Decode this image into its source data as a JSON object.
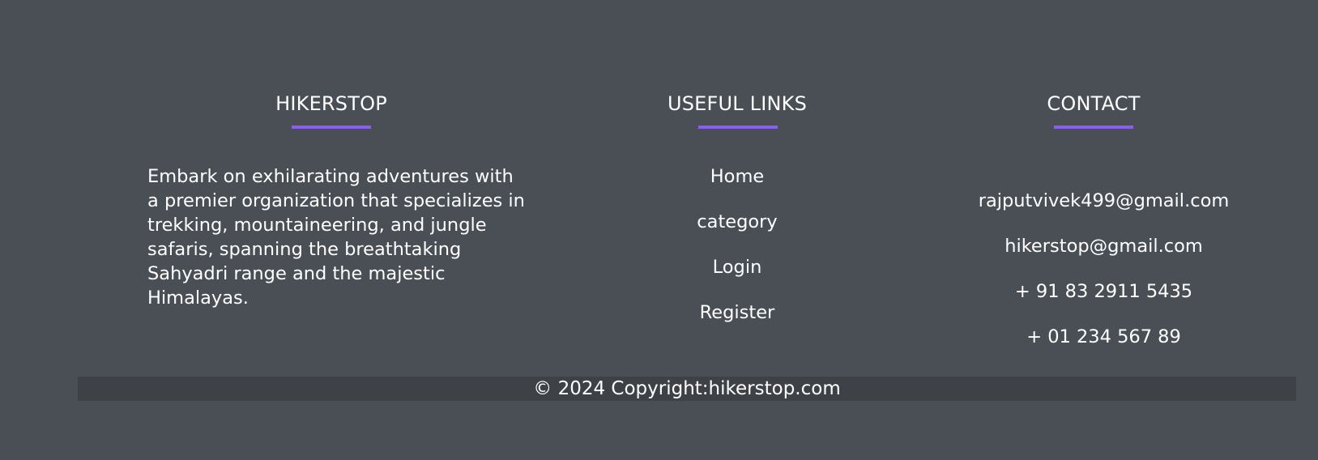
{
  "footer": {
    "columns": {
      "brand": {
        "title": "HIKERSTOP",
        "description": "Embark on exhilarating adventures with a premier organization that specializes in trekking, mountaineering, and jungle safaris, spanning the breathtaking Sahyadri range and the majestic Himalayas."
      },
      "links": {
        "title": "USEFUL LINKS",
        "items": [
          "Home",
          "category",
          "Login",
          "Register"
        ]
      },
      "contact": {
        "title": "CONTACT",
        "items": [
          "rajputvivek499@gmail.com",
          "hikerstop@gmail.com",
          "+ 91 83 2911 5435",
          "+ 01 234 567 89"
        ]
      }
    },
    "copyright": "© 2024 Copyright:hikerstop.com"
  },
  "colors": {
    "background": "#4a4e55",
    "accent": "#8b5cf6",
    "copyright_bar": "#3e4146"
  }
}
